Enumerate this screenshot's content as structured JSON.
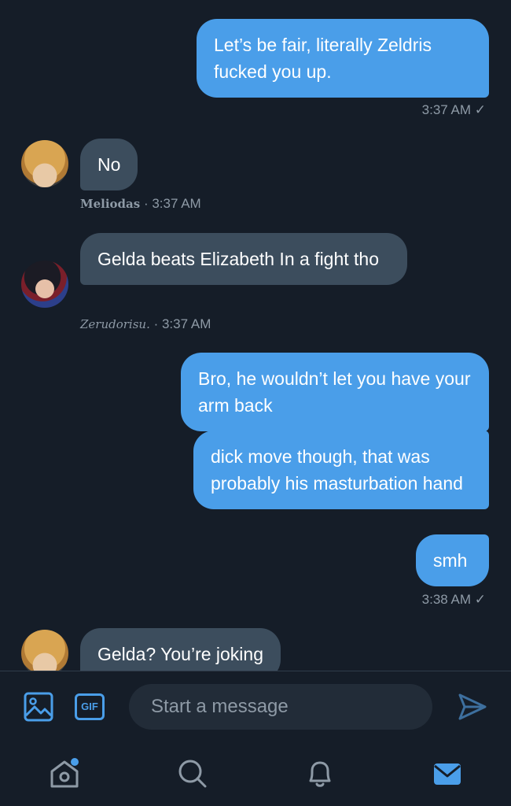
{
  "messages": [
    {
      "direction": "out",
      "text": "Let’s be fair, literally Zeldris fucked you up."
    },
    {
      "direction": "out",
      "meta": "3:37 AM ✓"
    },
    {
      "direction": "in",
      "text": "No",
      "sender": "Meliodas",
      "time": "· 3:37 AM"
    },
    {
      "direction": "in",
      "text": "Gelda beats Elizabeth In a fight tho",
      "sender": "Zerudorisu.",
      "time": "· 3:37 AM"
    },
    {
      "direction": "out",
      "text": "Bro, he wouldn’t let you have your arm back"
    },
    {
      "direction": "out",
      "text": "dick move though, that was probably his masturbation hand"
    },
    {
      "direction": "out",
      "text": "smh"
    },
    {
      "direction": "out",
      "meta": "3:38 AM ✓"
    },
    {
      "direction": "in",
      "text": "Gelda? You’re joking"
    }
  ],
  "composer": {
    "placeholder": "Start a message",
    "gif_label": "GIF"
  },
  "colors": {
    "background": "#151d28",
    "outgoing_bubble": "#4a9ee9",
    "incoming_bubble": "#3c4d5d",
    "accent": "#4a9ee9",
    "muted_text": "#8e9aa6",
    "notification_dot": "#4a9ee9"
  },
  "icons": {
    "media": "image-icon",
    "gif": "gif-icon",
    "send": "send-icon",
    "home": "home-icon",
    "search": "search-icon",
    "notifications": "bell-icon",
    "messages": "mail-icon"
  }
}
